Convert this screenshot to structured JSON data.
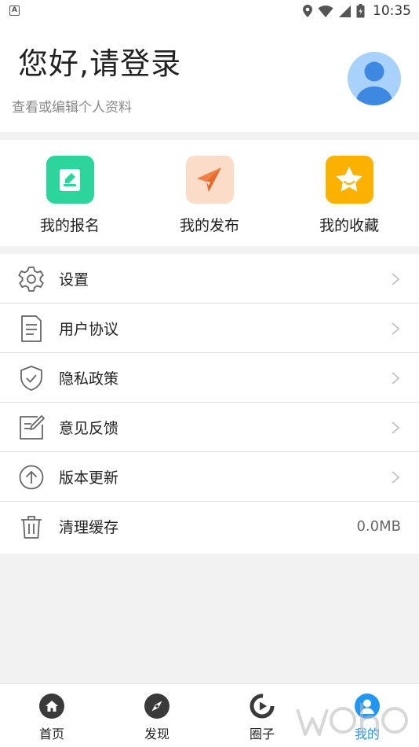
{
  "status_bar": {
    "time": "10:35",
    "notification_glyph": "A"
  },
  "profile": {
    "greeting": "您好,请登录",
    "subtitle": "查看或编辑个人资料",
    "avatar_icon": "user-avatar-icon"
  },
  "shortcuts": [
    {
      "label": "我的报名",
      "icon": "edit-note-icon",
      "color": "#2bd59b"
    },
    {
      "label": "我的发布",
      "icon": "paper-plane-icon",
      "color": "#fbdcc9"
    },
    {
      "label": "我的收藏",
      "icon": "star-icon",
      "color": "#fbb100"
    }
  ],
  "menu": [
    {
      "label": "设置",
      "icon": "gear-icon"
    },
    {
      "label": "用户协议",
      "icon": "document-icon"
    },
    {
      "label": "隐私政策",
      "icon": "shield-check-icon"
    },
    {
      "label": "意见反馈",
      "icon": "feedback-edit-icon"
    },
    {
      "label": "版本更新",
      "icon": "upload-circle-icon"
    },
    {
      "label": "清理缓存",
      "icon": "trash-icon",
      "value": "0.0MB"
    }
  ],
  "tabs": [
    {
      "label": "首页",
      "icon": "home-icon"
    },
    {
      "label": "发现",
      "icon": "compass-icon"
    },
    {
      "label": "圈子",
      "icon": "circle-play-icon"
    },
    {
      "label": "我的",
      "icon": "profile-icon",
      "active": true
    }
  ],
  "colors": {
    "accent": "#2196f3",
    "avatar_bg": "#a8d1fb",
    "avatar_fg": "#3d88e0"
  }
}
